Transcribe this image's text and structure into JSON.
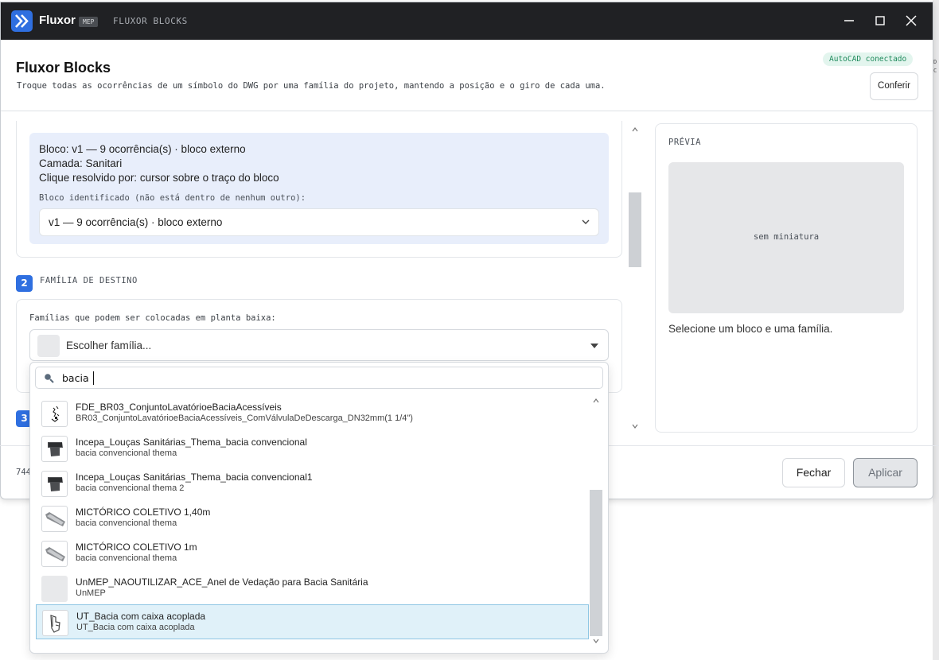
{
  "app": {
    "name": "Fluxor",
    "badge": "MEP",
    "subtitle": "FLUXOR BLOCKS"
  },
  "header": {
    "title": "Fluxor Blocks",
    "description": "Troque todas as ocorrências de um símbolo do DWG por uma família do projeto, mantendo a posição e o giro de cada uma.",
    "status": "AutoCAD conectado",
    "check_label": "Conferir"
  },
  "block": {
    "line1": "Bloco: v1 — 9 ocorrência(s) · bloco externo",
    "line2": "Camada: Sanitari",
    "line3": "Clique resolvido por: cursor sobre o traço do bloco",
    "identified_label": "Bloco identificado (não está dentro de nenhum outro):",
    "selected": "v1 — 9 ocorrência(s) · bloco externo"
  },
  "step2": {
    "number": "2",
    "label": "FAMÍLIA DE DESTINO"
  },
  "step3": {
    "number": "3"
  },
  "family": {
    "label": "Famílias que podem ser colocadas em planta baixa:",
    "placeholder": "Escolher família...",
    "search_value": "bacia",
    "options": [
      {
        "name": "FDE_BR03_ConjuntoLavatórioeBaciaAcessíveis",
        "sub": "BR03_ConjuntoLavatórioeBaciaAcessíveis_ComVálvulaDeDescarga_DN32mm(1 1/4\")",
        "icon": "fixture-drawing-icon"
      },
      {
        "name": "Incepa_Louças Sanitárias_Thema_bacia convencional",
        "sub": "bacia convencional thema",
        "icon": "toilet-icon"
      },
      {
        "name": "Incepa_Louças Sanitárias_Thema_bacia convencional1",
        "sub": "bacia convencional thema 2",
        "icon": "toilet-icon"
      },
      {
        "name": "MICTÓRICO COLETIVO 1,40m",
        "sub": "bacia convencional thema",
        "icon": "urinal-trough-icon"
      },
      {
        "name": "MICTÓRICO COLETIVO 1m",
        "sub": "bacia convencional thema",
        "icon": "urinal-trough-icon"
      },
      {
        "name": "UnMEP_NAOUTILIZAR_ACE_Anel de Vedação para Bacia Sanitária",
        "sub": "UnMEP",
        "icon": "no-thumbnail"
      },
      {
        "name": "UT_Bacia com caixa acoplada",
        "sub": "UT_Bacia com caixa acoplada",
        "icon": "toilet-tank-icon"
      }
    ]
  },
  "preview": {
    "label": "PRÉVIA",
    "empty": "sem miniatura",
    "hint": "Selecione um bloco e uma família."
  },
  "footer": {
    "info": "744",
    "close_label": "Fechar",
    "apply_label": "Aplicar"
  },
  "colors": {
    "accent": "#2f6fe0",
    "titlebar": "#202124",
    "status_bg": "#e3f5ee",
    "status_text": "#1f8a5c",
    "selected_row": "#e0f1f9"
  }
}
